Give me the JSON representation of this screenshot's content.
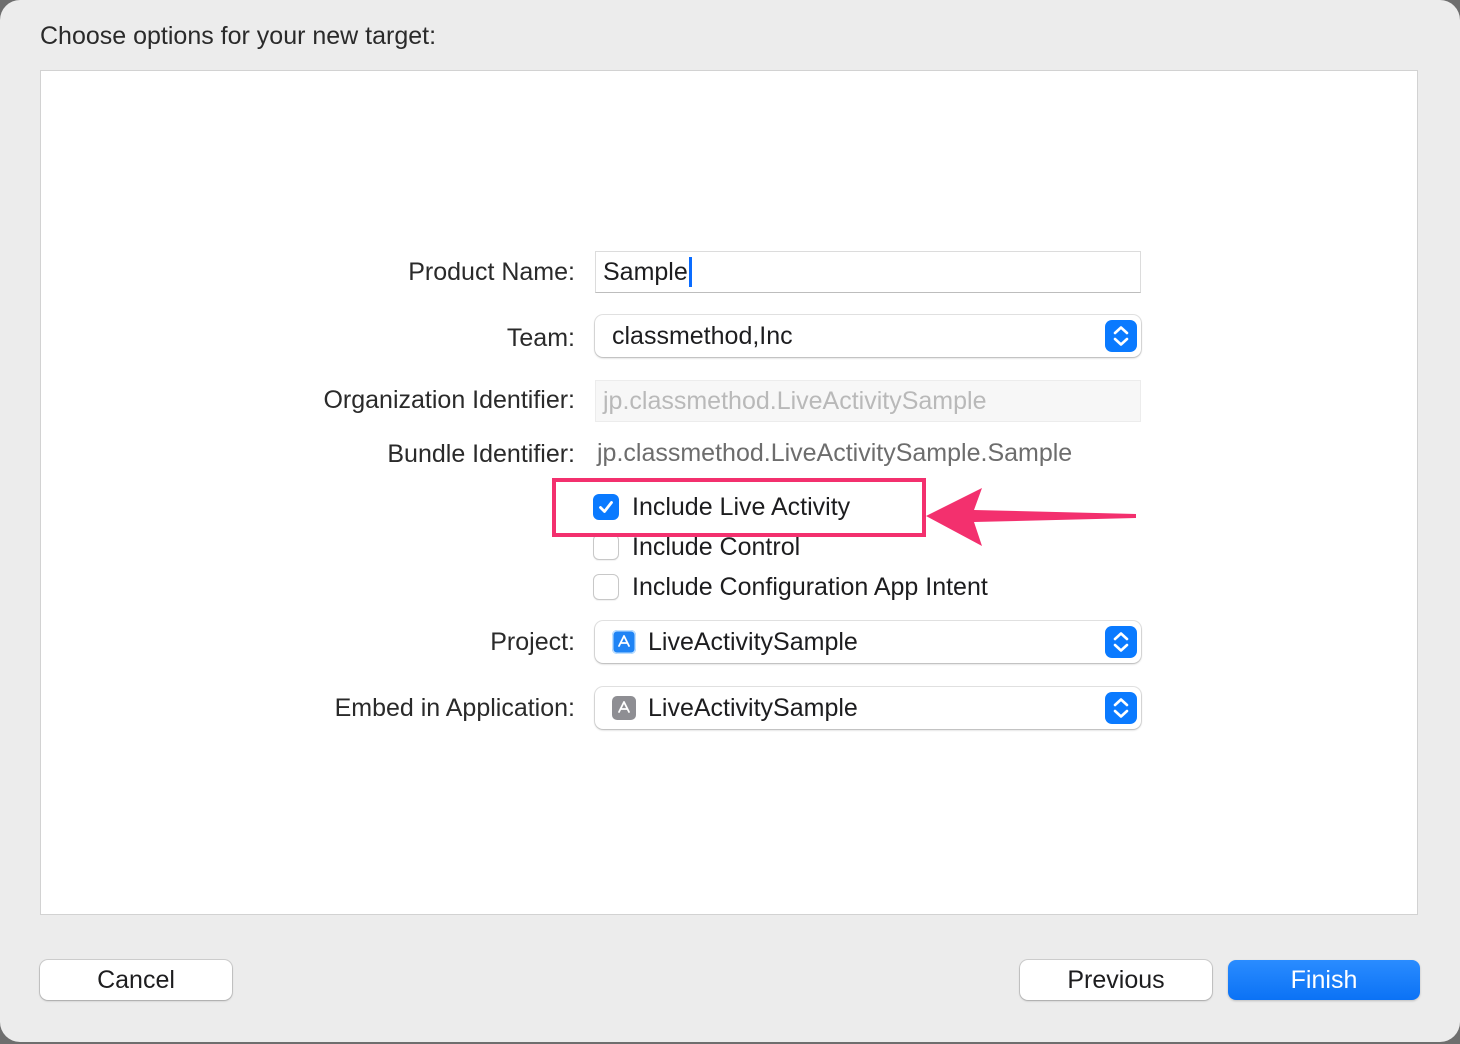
{
  "header": {
    "title": "Choose options for your new target:"
  },
  "form": {
    "product_name": {
      "label": "Product Name:",
      "value": "Sample"
    },
    "team": {
      "label": "Team:",
      "value": "classmethod,Inc"
    },
    "organization_identifier": {
      "label": "Organization Identifier:",
      "placeholder": "jp.classmethod.LiveActivitySample"
    },
    "bundle_identifier": {
      "label": "Bundle Identifier:",
      "value": "jp.classmethod.LiveActivitySample.Sample"
    },
    "checkboxes": [
      {
        "label": "Include Live Activity",
        "checked": true
      },
      {
        "label": "Include Control",
        "checked": false
      },
      {
        "label": "Include Configuration App Intent",
        "checked": false
      }
    ],
    "project": {
      "label": "Project:",
      "value": "LiveActivitySample",
      "icon": "app-store-icon"
    },
    "embed_in_application": {
      "label": "Embed in Application:",
      "value": "LiveActivitySample",
      "icon": "app-icon"
    }
  },
  "annotation": {
    "color": "#f3306e",
    "target": "Include Live Activity"
  },
  "footer": {
    "cancel_label": "Cancel",
    "previous_label": "Previous",
    "finish_label": "Finish"
  },
  "colors": {
    "accent": "#0a7aff",
    "panel": "#ffffff",
    "sheet": "#ececec"
  }
}
